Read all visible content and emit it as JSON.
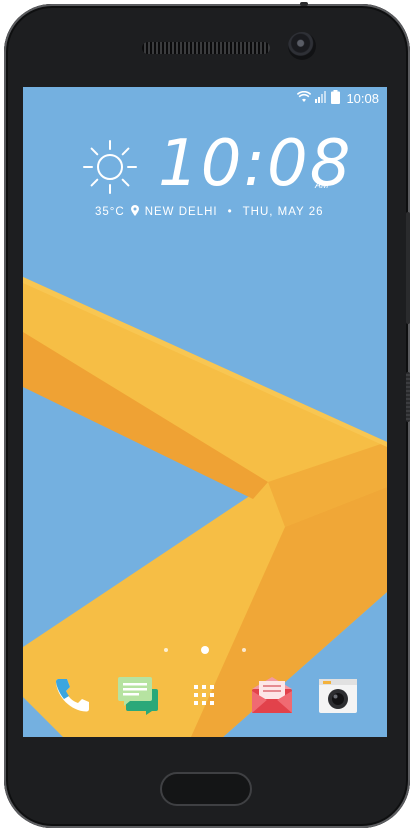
{
  "status_bar": {
    "time": "10:08",
    "icons": [
      "wifi-icon",
      "signal-icon",
      "battery-icon"
    ]
  },
  "clock_widget": {
    "time": "10:08",
    "ampm": "AM",
    "weather_icon": "sun-icon",
    "temperature": "35°C",
    "location": "NEW DELHI",
    "separator": "•",
    "date": "THU, MAY 26"
  },
  "pager": {
    "pages": 3,
    "active_page": 2
  },
  "dock": {
    "items": [
      {
        "name": "phone",
        "icon": "phone-icon"
      },
      {
        "name": "messages",
        "icon": "messages-icon"
      },
      {
        "name": "app-drawer",
        "icon": "app-drawer-icon"
      },
      {
        "name": "mail",
        "icon": "mail-icon"
      },
      {
        "name": "camera",
        "icon": "camera-icon"
      }
    ]
  },
  "colors": {
    "wallpaper_sky": "#74b0e0",
    "wallpaper_yellow": "#f6be45",
    "wallpaper_orange": "#efa234",
    "phone_body": "#1d1e20"
  }
}
